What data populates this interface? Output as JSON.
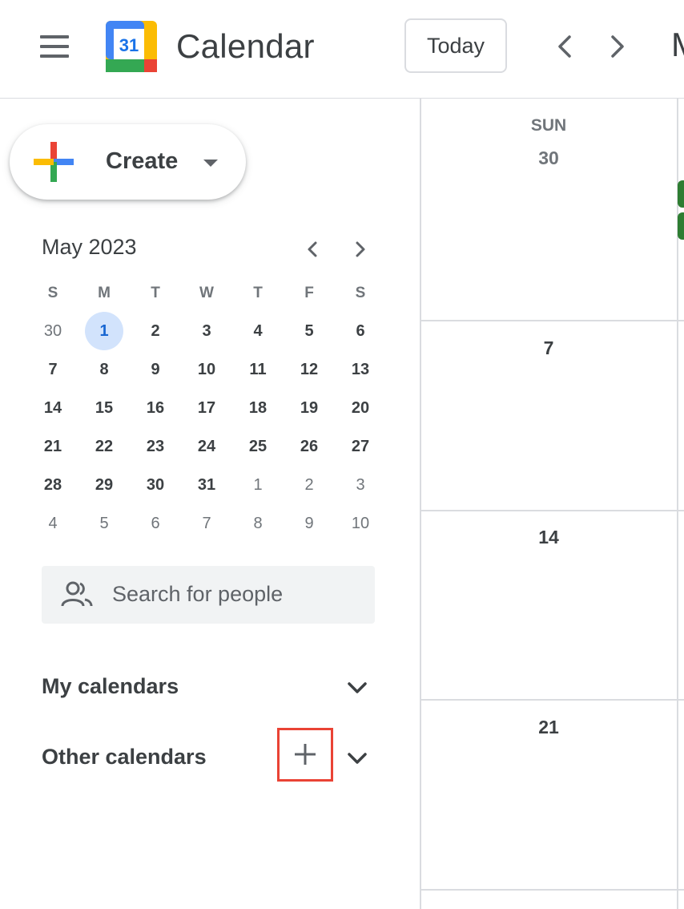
{
  "header": {
    "app_title": "Calendar",
    "logo_number": "31",
    "today_label": "Today",
    "cut_text": "M"
  },
  "sidebar": {
    "create_label": "Create",
    "mini_calendar": {
      "title": "May 2023",
      "weekdays": [
        "S",
        "M",
        "T",
        "W",
        "T",
        "F",
        "S"
      ],
      "weeks": [
        [
          "30",
          "1",
          "2",
          "3",
          "4",
          "5",
          "6"
        ],
        [
          "7",
          "8",
          "9",
          "10",
          "11",
          "12",
          "13"
        ],
        [
          "14",
          "15",
          "16",
          "17",
          "18",
          "19",
          "20"
        ],
        [
          "21",
          "22",
          "23",
          "24",
          "25",
          "26",
          "27"
        ],
        [
          "28",
          "29",
          "30",
          "31",
          "1",
          "2",
          "3"
        ],
        [
          "4",
          "5",
          "6",
          "7",
          "8",
          "9",
          "10"
        ]
      ]
    },
    "search_placeholder": "Search for people",
    "my_calendars_label": "My calendars",
    "other_calendars_label": "Other calendars"
  },
  "grid": {
    "day_of_week": "SUN",
    "day_numbers": [
      "30",
      "7",
      "14",
      "21"
    ]
  },
  "colors": {
    "accent_blue": "#1a73e8",
    "today_bg": "#d2e3fc",
    "highlight_red": "#ea4335",
    "event_green": "#2e7d32"
  }
}
